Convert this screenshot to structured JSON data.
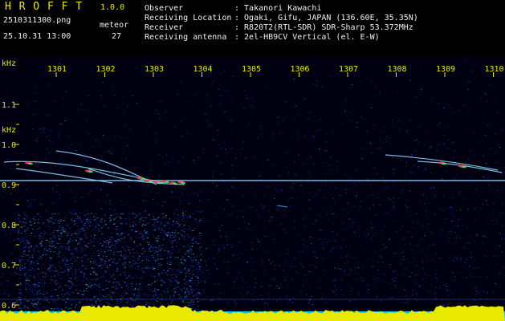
{
  "header": {
    "app_name": "H R O F F T",
    "version": "1.0.0",
    "filename": "2510311300.png",
    "datetime": "25.10.31 13:00",
    "meteor_label": "meteor",
    "meteor_count": "27",
    "info": [
      {
        "label": "Observer",
        "value": ": Takanori Kawachi"
      },
      {
        "label": "Receiving Location",
        "value": ": Ogaki, Gifu, JAPAN (136.60E, 35.35N)"
      },
      {
        "label": "Receiver",
        "value": ": R820T2(RTL-SDR) SDR-Sharp 53.372MHz"
      },
      {
        "label": "Receiving antenna",
        "value": ": 2el-HB9CV Vertical (el. E-W)"
      }
    ]
  },
  "chart_data": {
    "type": "heatmap",
    "xlabel": "",
    "ylabel": "kHz",
    "x_ticks": [
      "1301",
      "1302",
      "1303",
      "1304",
      "1305",
      "1306",
      "1307",
      "1308",
      "1309",
      "1310"
    ],
    "y_ticks": [
      "1.1",
      "1.0",
      "0.9",
      "0.8",
      "0.7",
      "0.6"
    ],
    "carrier_khz": 0.91
  },
  "colors": {
    "background": "#000000",
    "axis_text": "#e8e800",
    "noise": "#0a1a8a",
    "carrier": "#9ad8ff",
    "meteor": "#ff4040",
    "floor": "#e8e800",
    "floor_cyan": "#00c8ff"
  }
}
